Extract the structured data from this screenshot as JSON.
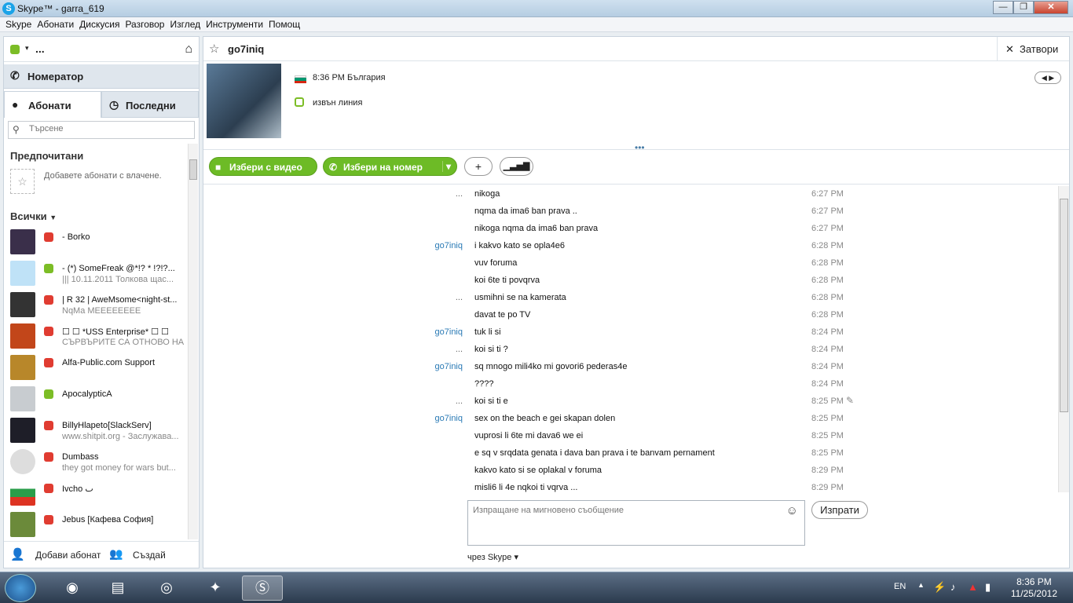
{
  "window": {
    "title": "Skype™ - garra_619",
    "logo": "S",
    "min": "—",
    "max": "❐",
    "close": "✕"
  },
  "menu": [
    "Skype",
    "Абонати",
    "Дискусия",
    "Разговор",
    "Изглед",
    "Инструменти",
    "Помощ"
  ],
  "left": {
    "user_display": "...",
    "dialpad_label": "Номератор",
    "tab_contacts": "Абонати",
    "tab_recent": "Последни",
    "search_placeholder": "Търсене",
    "favorites_title": "Предпочитани",
    "favorites_hint": "Добавете абонати с влачене.",
    "all_title": "Всички",
    "add_contact": "Добави абонат",
    "create": "Създай",
    "contacts": [
      {
        "name": "-               Borko",
        "mood": "",
        "status": "away"
      },
      {
        "name": "- (*) SomeFreak @*!?  * !?!?...",
        "mood": "||| 10.11.2011 Толкова щас...",
        "status": "online"
      },
      {
        "name": "| R 32 | AweMsome<night-st...",
        "mood": "NqMa MEEEEEEEE",
        "status": "away"
      },
      {
        "name": "☐ ☐ *USS Enterprise* ☐ ☐",
        "mood": "СЪРВЪРИТЕ СА ОТНОВО НА...",
        "status": "away"
      },
      {
        "name": "Alfa-Public.com Support",
        "mood": "",
        "status": "away"
      },
      {
        "name": "ApocalypticA",
        "mood": "",
        "status": "online"
      },
      {
        "name": "BillyHlapeto[SlackServ]",
        "mood": "www.shitpit.org - Заслужава...",
        "status": "away"
      },
      {
        "name": "Dumbass",
        "mood": "they got money for wars but...",
        "status": "away"
      },
      {
        "name": "Ivcho ٮ",
        "mood": "",
        "status": "away"
      },
      {
        "name": "Jebus [Кафева София]",
        "mood": "",
        "status": "away"
      }
    ]
  },
  "chat": {
    "contact_name": "go7iniq",
    "close_label": "Затвори",
    "local_time": "8:36 PM България",
    "presence": "извън линия",
    "video_call": "Избери с видео",
    "voice_call": "Избери на номер",
    "add_icon": "+",
    "compose_placeholder": "Изпращане на мигновено съобщение",
    "send_label": "Изпрати",
    "via_label": "чрез Skype ▾",
    "messages": [
      {
        "from": "...",
        "text": "nikoga",
        "time": "6:27 PM"
      },
      {
        "from": "",
        "text": "nqma da ima6 ban prava ..",
        "time": "6:27 PM"
      },
      {
        "from": "",
        "text": "nikoga nqma da ima6 ban prava",
        "time": "6:27 PM"
      },
      {
        "from": "go7iniq",
        "text": "i kakvo kato se opla4e6",
        "time": "6:28 PM"
      },
      {
        "from": "",
        "text": "vuv foruma",
        "time": "6:28 PM"
      },
      {
        "from": "",
        "text": "koi 6te ti povqrva",
        "time": "6:28 PM"
      },
      {
        "from": "...",
        "text": "usmihni se na kamerata",
        "time": "6:28 PM"
      },
      {
        "from": "",
        "text": "davat te po TV",
        "time": "6:28 PM"
      },
      {
        "from": "go7iniq",
        "text": "tuk li si",
        "time": "8:24 PM"
      },
      {
        "from": "...",
        "text": "koi si ti ?",
        "time": "8:24 PM"
      },
      {
        "from": "go7iniq",
        "text": "sq mnogo mili4ko mi govori6 pederas4e",
        "time": "8:24 PM"
      },
      {
        "from": "",
        "text": "????",
        "time": "8:24 PM"
      },
      {
        "from": "...",
        "text": "koi si ti e",
        "time": "8:25 PM"
      },
      {
        "from": "go7iniq",
        "text": "sex on the beach e gei skapan dolen",
        "time": "8:25 PM"
      },
      {
        "from": "",
        "text": "vuprosi li 6te mi dava6 we ei",
        "time": "8:25 PM"
      },
      {
        "from": "",
        "text": "e sq v srqdata genata i dava ban prava i te banvam pernament",
        "time": "8:25 PM"
      },
      {
        "from": "",
        "text": "kakvo kato si se oplakal v foruma",
        "time": "8:29 PM"
      },
      {
        "from": "",
        "text": "misli6 li 4e nqkoi ti vqrva ...",
        "time": "8:29 PM"
      }
    ]
  },
  "taskbar": {
    "lang": "EN",
    "time": "8:36 PM",
    "date": "11/25/2012"
  },
  "colors": {
    "online": "#7cbd26",
    "away": "#e03c31",
    "link": "#2a7ab5",
    "call_green": "#6dbb26"
  }
}
